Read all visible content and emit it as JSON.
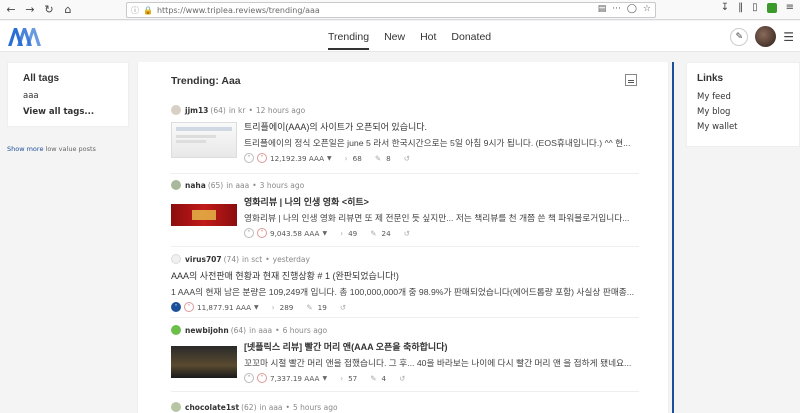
{
  "browser": {
    "url": "https://www.triplea.reviews/trending/aaa"
  },
  "header": {
    "tabs": [
      {
        "label": "Trending",
        "active": true
      },
      {
        "label": "New",
        "active": false
      },
      {
        "label": "Hot",
        "active": false
      },
      {
        "label": "Donated",
        "active": false
      }
    ]
  },
  "left_sidebar": {
    "title": "All tags",
    "tags": [
      "aaa"
    ],
    "view_all": "View all tags...",
    "show_more_link": "Show more",
    "show_more_rest": " low value posts"
  },
  "feed": {
    "title": "Trending: Aaa",
    "posts": [
      {
        "author": "jjm13",
        "rep": "(64)",
        "category": "in kr",
        "time": "12 hours ago",
        "title": "트리플에이(AAA)의 사이트가 오픈되어 있습니다.",
        "excerpt": "트리플에이의 정식 오픈일은 june 5 라서 한국시간으로는 5일 아침 9시가 됩니다. (EOS휴내입니다.) ^^ 현...",
        "payout": "12,192.39 AAA",
        "votes": "68",
        "comments": "8",
        "thumb": "screenshot"
      },
      {
        "author": "naha",
        "rep": "(65)",
        "category": "in aaa",
        "time": "3 hours ago",
        "title": "영화리뷰 | 나의 인생 영화 <히트>",
        "excerpt": "영화리뷰 | 나의 인생 영화 리뷰면 또 제 전문인 듯 싶지만... 저는 책리뷰를 천 개쯤 쓴 책 파워블로거입니다...",
        "payout": "9,043.58 AAA",
        "votes": "49",
        "comments": "24",
        "thumb": "red"
      },
      {
        "author": "virus707",
        "rep": "(74)",
        "category": "in sct",
        "time": "yesterday",
        "title": "AAA의 사전판매 현황과 현재 진행상황 # 1 (완판되었습니다!)",
        "excerpt": "1 AAA의 현재 남은 분량은 109,249개 입니다. 총 100,000,000개 중 98.9%가 판매되었습니다(에어드롭량 포함) 사실상 판매종...",
        "payout": "11,877.91 AAA",
        "votes": "289",
        "comments": "19",
        "thumb": "none"
      },
      {
        "author": "newbijohn",
        "rep": "(64)",
        "category": "in aaa",
        "time": "6 hours ago",
        "title": "[넷플릭스 리뷰] 빨간 머리 앤(AAA 오픈을 축하합니다)",
        "excerpt": "꼬꼬마 시절 빨간 머리 앤을 접했습니다. 그 후... 40을 바라보는 나이에 다시 빨간 머리 앤 을 접하게 됐네요...",
        "payout": "7,337.19 AAA",
        "votes": "57",
        "comments": "4",
        "thumb": "dark"
      },
      {
        "author": "chocolate1st",
        "rep": "(62)",
        "category": "in aaa",
        "time": "5 hours ago"
      }
    ]
  },
  "right_sidebar": {
    "title": "Links",
    "links": [
      "My feed",
      "My blog",
      "My wallet"
    ]
  },
  "colors": {
    "accent": "#1a5099",
    "logo": "#2a6fd6"
  }
}
